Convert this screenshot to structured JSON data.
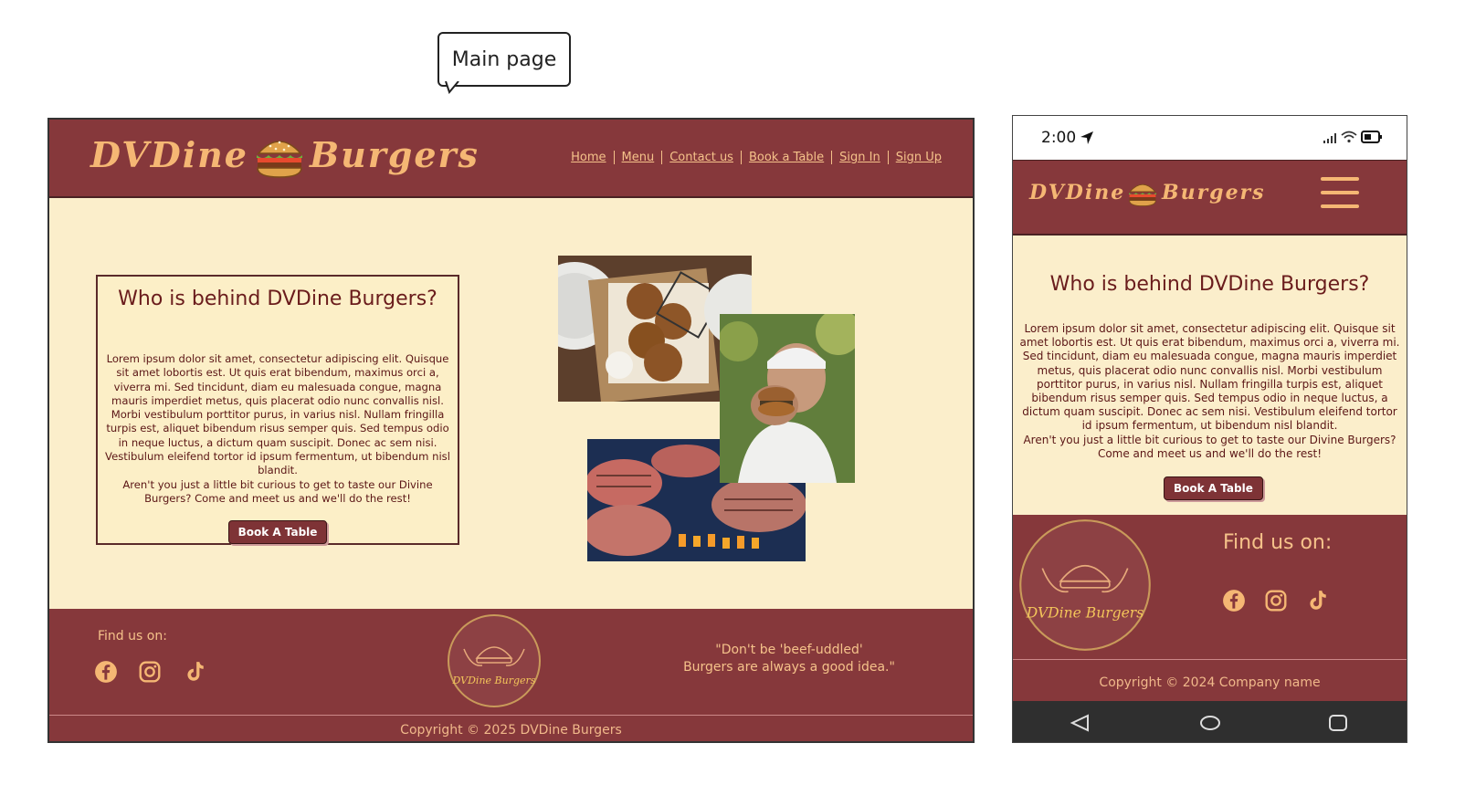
{
  "annotation": {
    "label": "Main page"
  },
  "brand": {
    "name_left": "DVDine",
    "name_right": "Burgers",
    "logo_text": "DVDine Burgers",
    "colors": {
      "primary": "#86383b",
      "accent": "#f5b774",
      "background": "#fbeecb"
    }
  },
  "nav": {
    "items": [
      {
        "label": "Home"
      },
      {
        "label": "Menu"
      },
      {
        "label": "Contact us"
      },
      {
        "label": "Book a Table"
      },
      {
        "label": "Sign In"
      },
      {
        "label": "Sign Up"
      }
    ]
  },
  "about": {
    "title": "Who is behind DVDine Burgers?",
    "body": "Lorem ipsum dolor sit amet, consectetur adipiscing elit. Quisque sit amet lobortis est. Ut quis erat bibendum, maximus orci a, viverra mi. Sed tincidunt, diam eu malesuada congue, magna mauris imperdiet metus, quis placerat odio nunc convallis nisl. Morbi vestibulum porttitor purus, in varius nisl. Nullam fringilla turpis est, aliquet bibendum risus semper quis. Sed tempus odio in neque luctus, a dictum quam suscipit. Donec ac sem nisi. Vestibulum eleifend tortor id ipsum fermentum, ut bibendum nisl blandit.",
    "tagline": "Aren't you just a little bit curious to get to taste our Divine Burgers? Come and meet us and we'll do the rest!",
    "cta": "Book A Table"
  },
  "gallery": [
    "burger-buns-photo",
    "man-holding-burger-photo",
    "grilling-patties-photo"
  ],
  "footer": {
    "find_us": "Find us on:",
    "socials": [
      "facebook-icon",
      "instagram-icon",
      "tiktok-icon"
    ],
    "quote_line1": "\"Don't be 'beef-uddled'",
    "quote_line2": "Burgers are always a good idea.\"",
    "copyright": "Copyright © 2025 DVDine Burgers"
  },
  "mobile": {
    "status_time": "2:00",
    "copyright": "Copyright © 2024 Company name"
  }
}
